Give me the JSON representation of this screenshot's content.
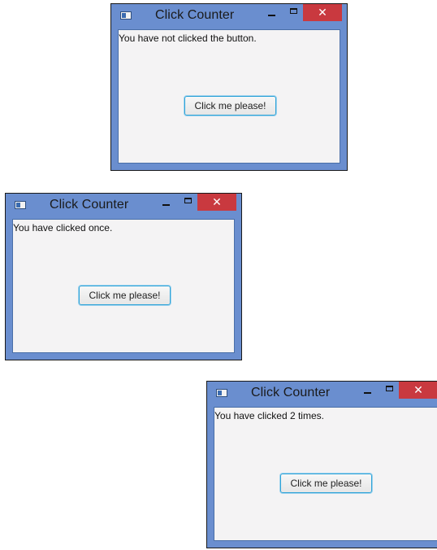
{
  "windows": [
    {
      "title": "Click Counter",
      "status": "You have not clicked the button.",
      "button_label": "Click me please!",
      "close_symbol": "✕"
    },
    {
      "title": "Click Counter",
      "status": "You have clicked once.",
      "button_label": "Click me please!",
      "close_symbol": "✕"
    },
    {
      "title": "Click Counter",
      "status": "You have clicked 2 times.",
      "button_label": "Click me please!",
      "close_symbol": "✕"
    }
  ]
}
